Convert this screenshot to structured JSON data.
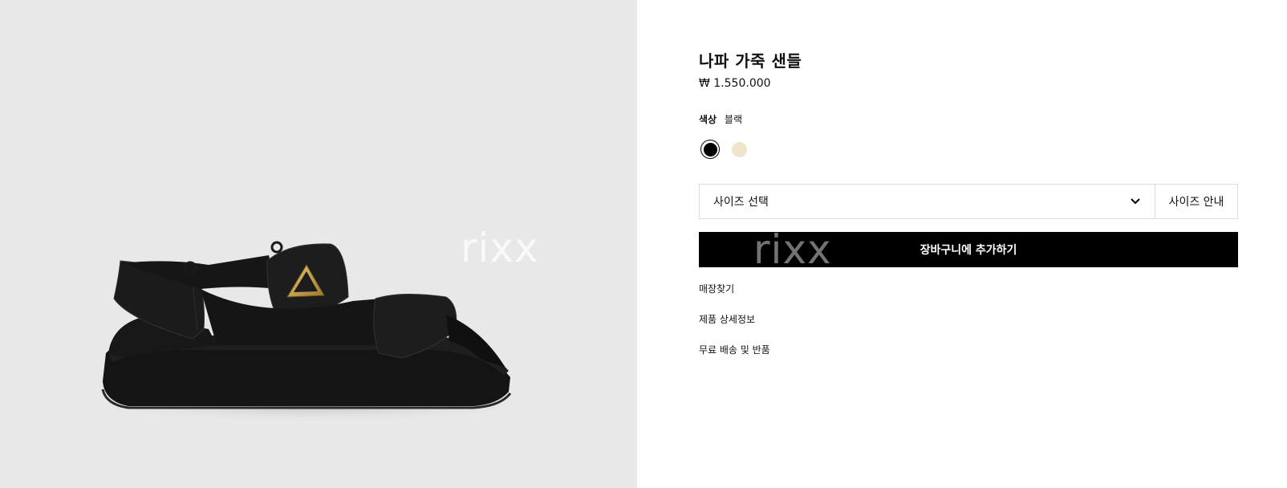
{
  "product": {
    "title": "나파 가죽 샌들",
    "price": "₩ 1.550.000",
    "image_alt": "black nappa leather sandal with triangle logo"
  },
  "color": {
    "label": "색상",
    "selected_name": "블랙",
    "swatches": [
      {
        "name": "블랙",
        "hex": "#000000",
        "selected": true
      },
      {
        "name": "베이지",
        "hex": "#efe5cc",
        "selected": false
      }
    ]
  },
  "size": {
    "placeholder": "사이즈 선택",
    "guide_label": "사이즈 안내"
  },
  "cart_button": "장바구니에 추가하기",
  "links": [
    "매장찾기",
    "제품 상세정보",
    "무료 배송 및 반품"
  ],
  "watermark": "rixx",
  "icons": {
    "dropdown": "chevron-down-icon"
  }
}
